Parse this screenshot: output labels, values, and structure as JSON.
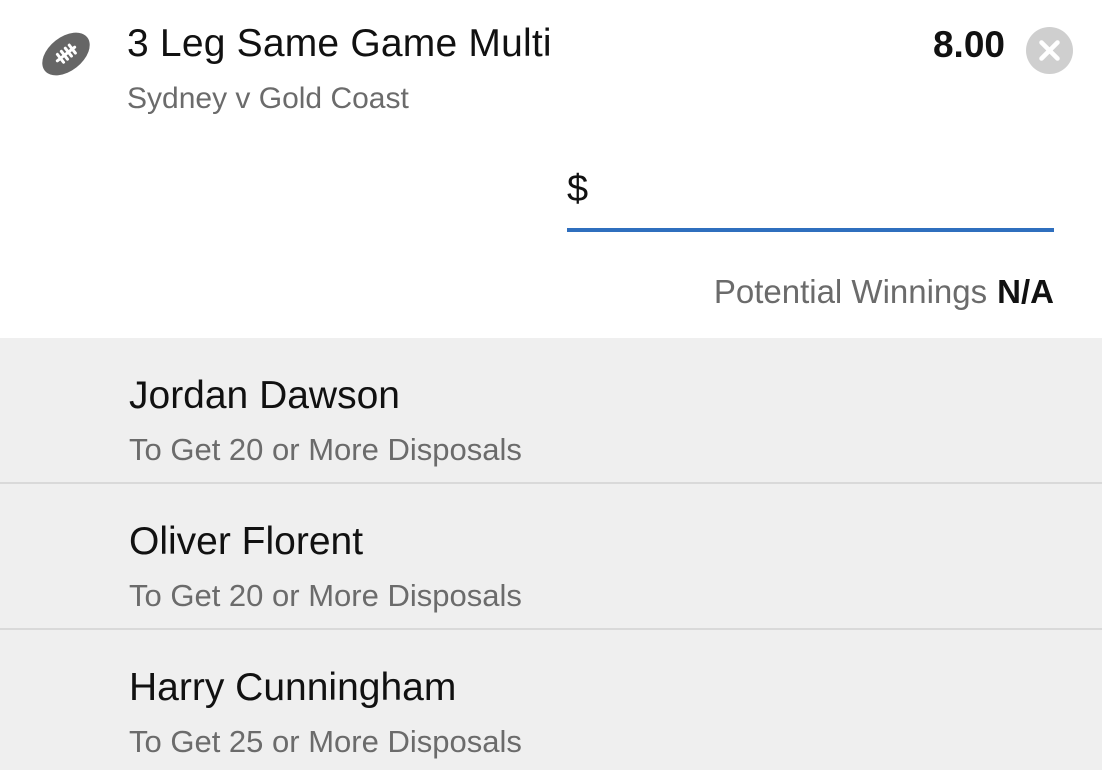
{
  "bet": {
    "sport_icon": "football-icon",
    "title": "3 Leg Same Game Multi",
    "match": "Sydney v Gold Coast",
    "odds": "8.00",
    "remove_icon": "close-icon"
  },
  "stake": {
    "currency_symbol": "$",
    "value": "",
    "placeholder": ""
  },
  "winnings": {
    "label": "Potential Winnings",
    "value": "N/A"
  },
  "legs": [
    {
      "player": "Jordan Dawson",
      "market": "To Get 20 or More Disposals"
    },
    {
      "player": "Oliver Florent",
      "market": "To Get 20 or More Disposals"
    },
    {
      "player": "Harry Cunningham",
      "market": "To Get 25 or More Disposals"
    }
  ],
  "colors": {
    "accent": "#2f6fbe",
    "icon_grey": "#666666",
    "leg_background": "#efefef"
  }
}
